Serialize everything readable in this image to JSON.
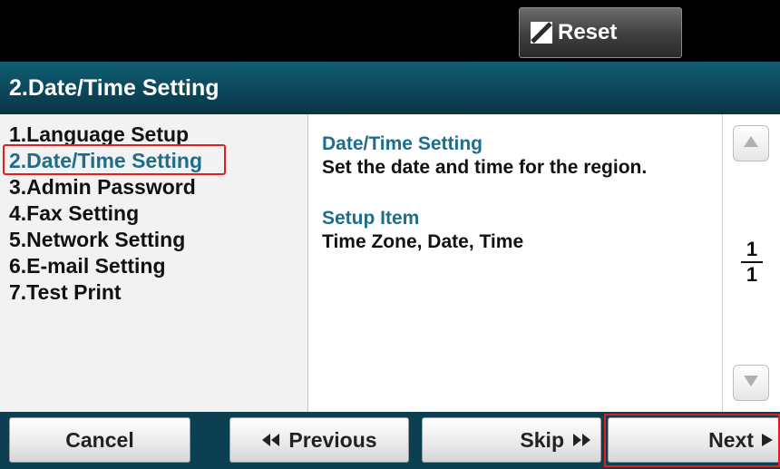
{
  "header": {
    "reset_label": "Reset",
    "title": "2.Date/Time Setting"
  },
  "menu": {
    "items": [
      {
        "label": "1.Language Setup"
      },
      {
        "label": "2.Date/Time Setting"
      },
      {
        "label": "3.Admin Password"
      },
      {
        "label": "4.Fax Setting"
      },
      {
        "label": "5.Network Setting"
      },
      {
        "label": "6.E-mail Setting"
      },
      {
        "label": "7.Test Print"
      }
    ],
    "active_index": 1
  },
  "detail": {
    "heading": "Date/Time Setting",
    "description": "Set the date and time for the region.",
    "setup_heading": "Setup Item",
    "setup_items": "Time Zone, Date, Time"
  },
  "pagination": {
    "current": "1",
    "total": "1"
  },
  "footer": {
    "cancel_label": "Cancel",
    "previous_label": "Previous",
    "skip_label": "Skip",
    "next_label": "Next"
  },
  "icons": {
    "reset": "reset-icon",
    "scroll_up": "triangle-up-icon",
    "scroll_down": "triangle-down-icon",
    "previous": "double-chevron-left-icon",
    "skip": "double-chevron-right-icon",
    "next": "triangle-right-icon"
  },
  "colors": {
    "title_bar": "#0b4558",
    "active_item": "#1e6d8a",
    "highlight": "#e02020"
  }
}
